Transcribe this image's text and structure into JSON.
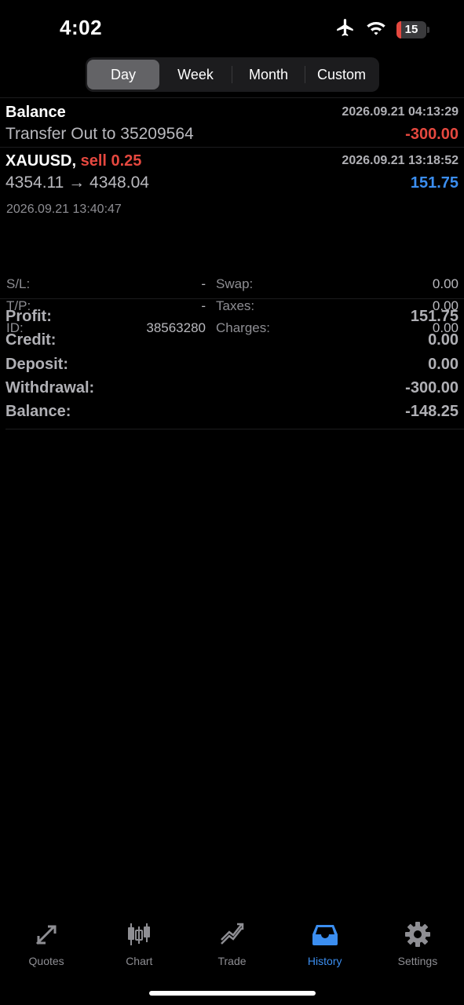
{
  "status_bar": {
    "time": "4:02",
    "battery_level": "15",
    "icons": [
      "airplane-icon",
      "wifi-icon",
      "battery-icon"
    ]
  },
  "segments": {
    "items": [
      "Day",
      "Week",
      "Month",
      "Custom"
    ],
    "selected": "Day"
  },
  "history": {
    "balance_entry": {
      "title": "Balance",
      "time": "2026.09.21 04:13:29",
      "description": "Transfer Out to 35209564",
      "amount": "-300.00"
    },
    "trade_entry": {
      "symbol": "XAUUSD,",
      "side": "sell 0.25",
      "open_time": "2026.09.21 13:18:52",
      "prices": "4354.11 → 4348.04",
      "profit": "151.75",
      "close_time": "2026.09.21 13:40:47",
      "details": {
        "sl_label": "S/L:",
        "sl_value": "-",
        "tp_label": "T/P:",
        "tp_value": "-",
        "id_label": "ID:",
        "id_value": "38563280",
        "swap_label": "Swap:",
        "swap_value": "0.00",
        "taxes_label": "Taxes:",
        "taxes_value": "0.00",
        "charges_label": "Charges:",
        "charges_value": "0.00"
      }
    }
  },
  "summary": {
    "profit_label": "Profit:",
    "profit_value": "151.75",
    "credit_label": "Credit:",
    "credit_value": "0.00",
    "deposit_label": "Deposit:",
    "deposit_value": "0.00",
    "withdrawal_label": "Withdrawal:",
    "withdrawal_value": "-300.00",
    "balance_label": "Balance:",
    "balance_value": "-148.25"
  },
  "tabbar": {
    "items": [
      {
        "label": "Quotes",
        "icon": "quotes-icon"
      },
      {
        "label": "Chart",
        "icon": "chart-icon"
      },
      {
        "label": "Trade",
        "icon": "trade-icon"
      },
      {
        "label": "History",
        "icon": "history-icon"
      },
      {
        "label": "Settings",
        "icon": "settings-icon"
      }
    ],
    "active": "History"
  },
  "colors": {
    "negative": "#e5483f",
    "positive": "#3b8ef0",
    "active_tab": "#3b8ef0",
    "muted": "#8e8e93"
  }
}
